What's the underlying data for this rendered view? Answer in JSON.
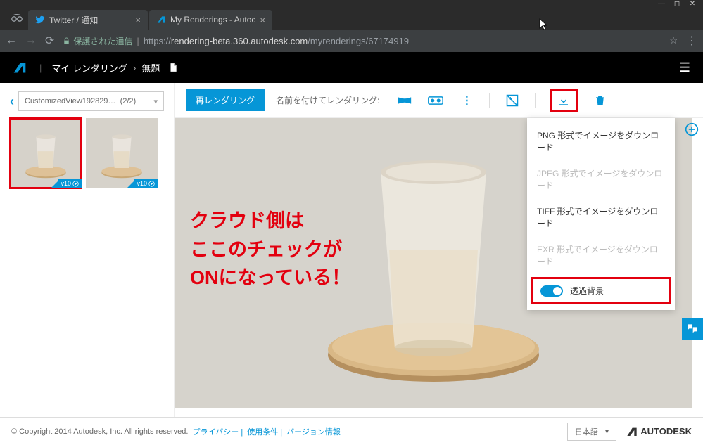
{
  "window": {
    "tabs": [
      {
        "title": "Twitter / 通知",
        "favicon_color": "#1da1f2"
      },
      {
        "title": "My Renderings - Autoc",
        "favicon_color": "#0696d7"
      }
    ],
    "url_secure_label": "保護された通信",
    "url_display_prefix": "https://",
    "url_domain": "rendering-beta.360.autodesk.com",
    "url_path": "/myrenderings/67174919"
  },
  "header": {
    "breadcrumb_root": "マイ レンダリング",
    "breadcrumb_current": "無題"
  },
  "sidebar": {
    "view_name": "CustomizedView192829…",
    "view_count": "(2/2)",
    "thumb_badge": "v10"
  },
  "toolbar": {
    "rerender_label": "再レンダリング",
    "saveas_label": "名前を付けてレンダリング:"
  },
  "download_menu": {
    "items": [
      {
        "label": "PNG 形式でイメージをダウンロード",
        "enabled": true
      },
      {
        "label": "JPEG 形式でイメージをダウンロード",
        "enabled": false
      },
      {
        "label": "TIFF 形式でイメージをダウンロード",
        "enabled": true
      },
      {
        "label": "EXR 形式でイメージをダウンロード",
        "enabled": false
      }
    ],
    "toggle_label": "透過背景",
    "toggle_on": true
  },
  "annotation": {
    "line1": "クラウド側は",
    "line2": "ここのチェックが",
    "line3": "ONになっている！"
  },
  "footer": {
    "copyright": "© Copyright 2014 Autodesk, Inc. All rights reserved.",
    "links": [
      "プライバシー",
      "使用条件",
      "バージョン情報"
    ],
    "language": "日本語",
    "brand": "AUTODESK"
  }
}
